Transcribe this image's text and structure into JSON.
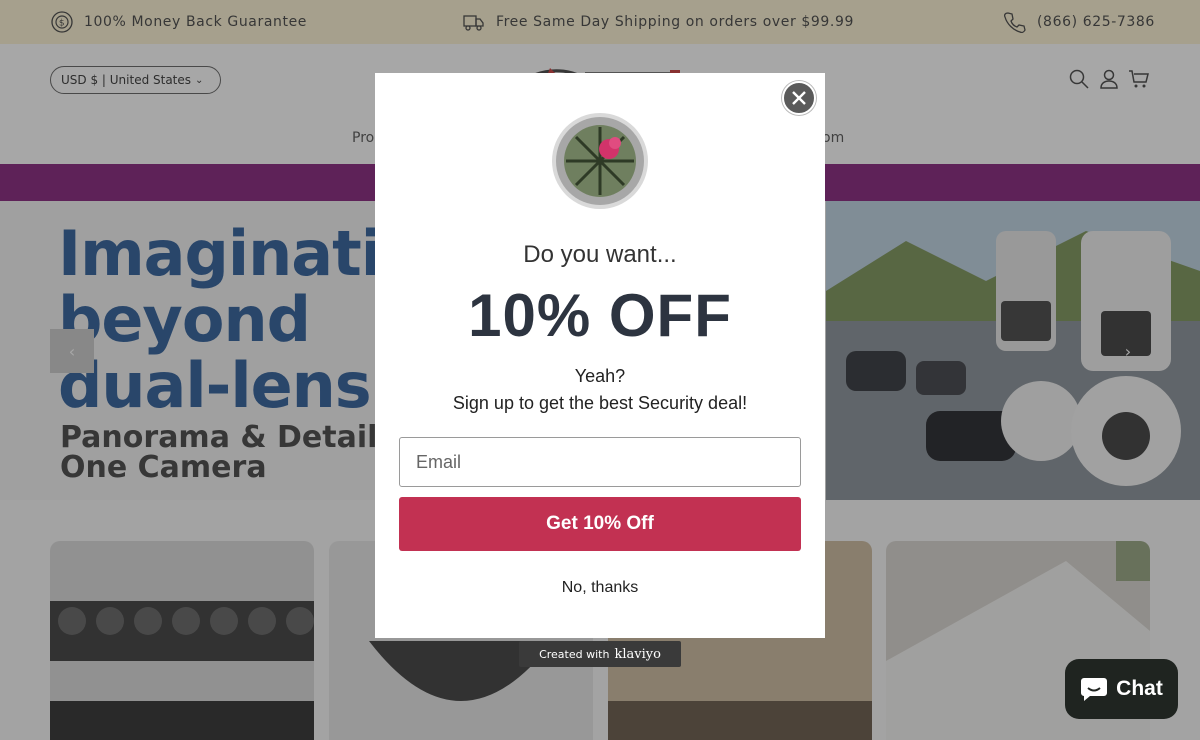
{
  "announcement": {
    "guarantee": "100% Money Back Guarantee",
    "shipping": "Free Same Day Shipping on orders over $99.99",
    "phone": "(866) 625-7386"
  },
  "header": {
    "currency": "USD $ | United States",
    "nav_left_partial": "Pro",
    "nav_right_partial": "om"
  },
  "hero": {
    "headline_line1": "Imaginatio",
    "headline_line2": "beyond",
    "headline_line3": "dual-lens",
    "sub_line1": "Panorama & Details in",
    "sub_line2": "One Camera",
    "prev_icon": "chevron-left-icon",
    "next_icon": "chevron-right-icon"
  },
  "modal": {
    "title": "Do you want...",
    "offer": "10% OFF",
    "line1": "Yeah?",
    "line2": "Sign up to get the best Security deal!",
    "email_placeholder": "Email",
    "cta": "Get 10% Off",
    "dismiss": "No, thanks"
  },
  "footer_badge": {
    "text": "Created with",
    "brand": "klaviyo"
  },
  "chat": {
    "label": "Chat"
  },
  "colors": {
    "announcement_bg": "#fdf3cf",
    "promo_bar": "#7a0e6f",
    "cta": "#c23152",
    "headline": "#1b4f91"
  }
}
